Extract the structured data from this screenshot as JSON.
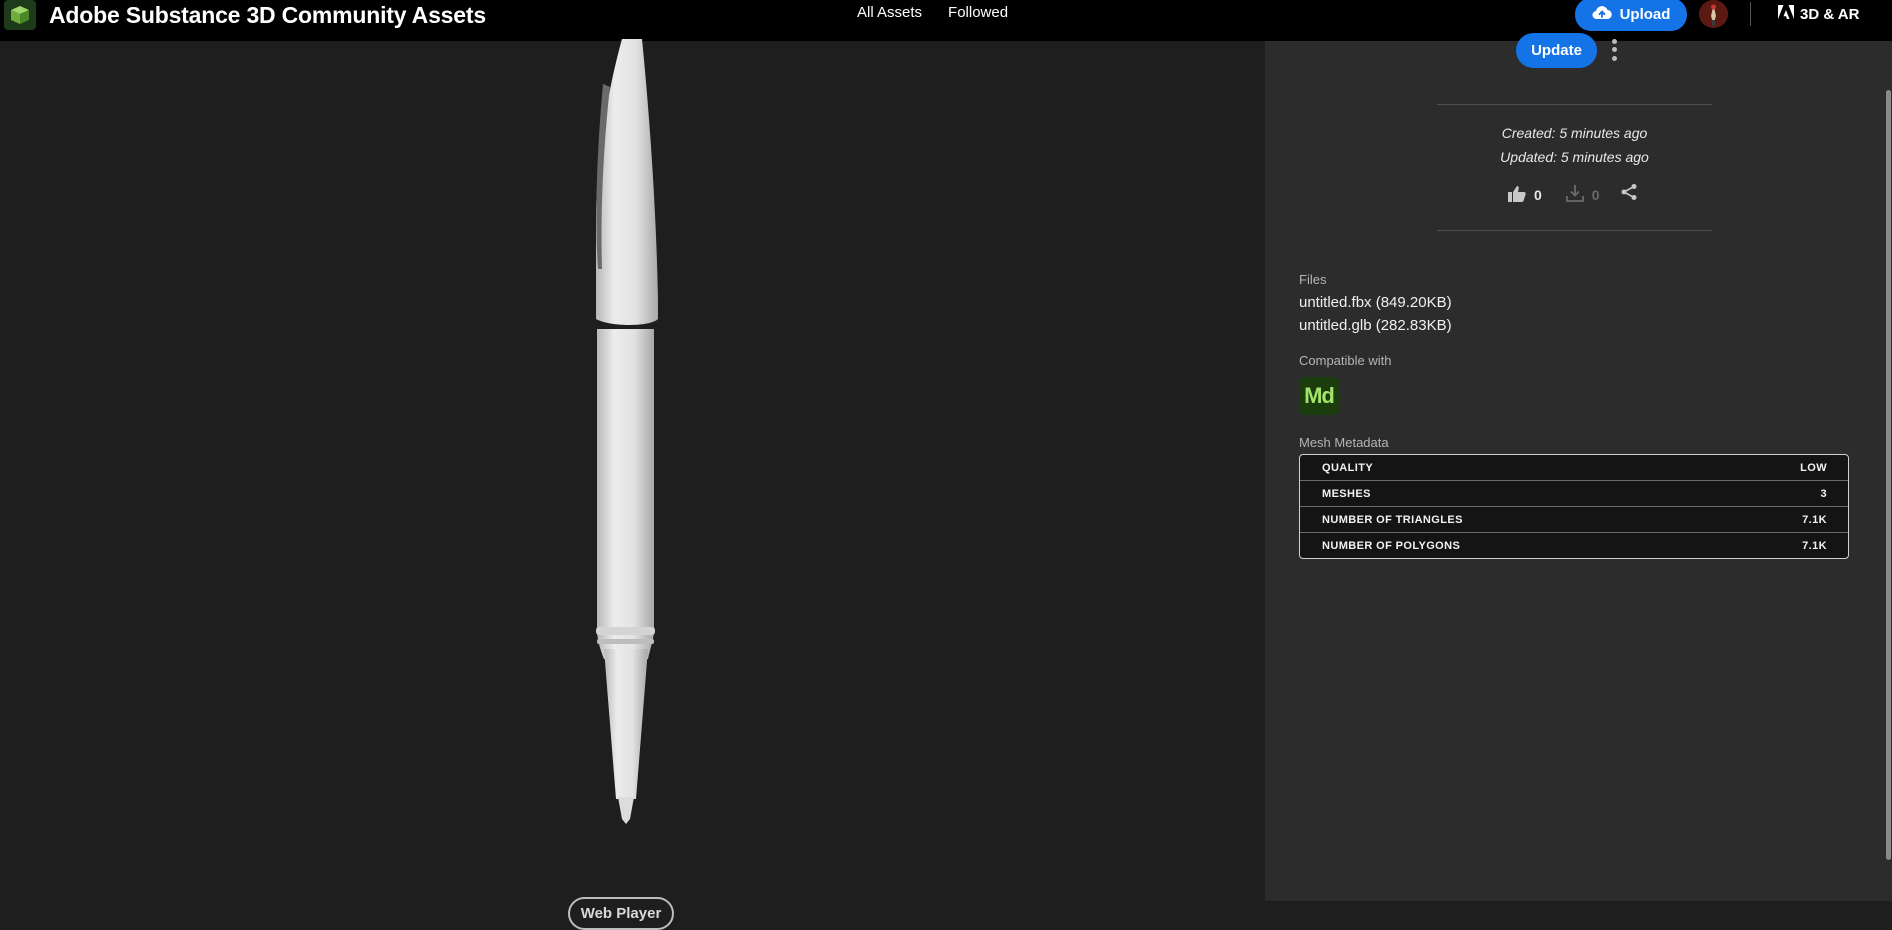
{
  "header": {
    "title": "Adobe Substance 3D Community Assets",
    "nav": [
      "All Assets",
      "Followed"
    ],
    "upload_label": "Upload",
    "adobe_link": "3D & AR"
  },
  "asset": {
    "update_label": "Update",
    "created": "Created: 5 minutes ago",
    "updated": "Updated: 5 minutes ago",
    "likes": "0",
    "downloads": "0"
  },
  "files": {
    "label": "Files",
    "items": [
      "untitled.fbx (849.20KB)",
      "untitled.glb (282.83KB)"
    ]
  },
  "compatible": {
    "label": "Compatible with",
    "app": "Md"
  },
  "mesh_metadata": {
    "label": "Mesh Metadata",
    "rows": [
      {
        "key": "QUALITY",
        "value": "LOW"
      },
      {
        "key": "MESHES",
        "value": "3"
      },
      {
        "key": "NUMBER OF TRIANGLES",
        "value": "7.1K"
      },
      {
        "key": "NUMBER OF POLYGONS",
        "value": "7.1K"
      }
    ]
  },
  "viewer": {
    "web_player_label": "Web Player"
  },
  "colors": {
    "accent": "#1473e6",
    "topbar": "#000000",
    "viewer_bg": "#1e1e1e",
    "sidebar_bg": "#2c2c2c",
    "md_badge": "#1b3d0e",
    "md_text": "#a4e26b"
  },
  "icons": [
    "substance-logo-icon",
    "cloud-upload-icon",
    "adobe-icon",
    "thumbs-up-icon",
    "download-icon",
    "share-icon",
    "kebab-menu-icon"
  ]
}
